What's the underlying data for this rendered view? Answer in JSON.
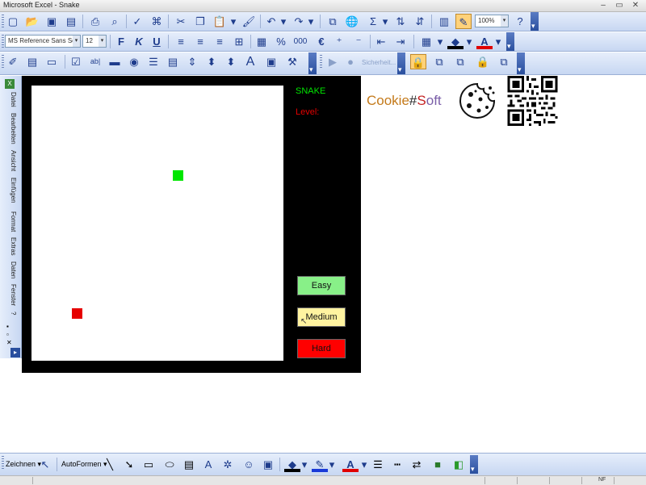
{
  "window": {
    "title": "Microsoft Excel - Snake",
    "minimize": "–",
    "restore": "▭",
    "close": "✕"
  },
  "formatting": {
    "font": "MS Reference Sans Serif",
    "size": "12",
    "zoom": "100%",
    "percent_symbol": "%",
    "thousands_symbol": "000",
    "euro_symbol": "€"
  },
  "controls_toolbar": {
    "security_label": "Sicherheit..."
  },
  "side_menu": [
    "Datei",
    "Bearbeiten",
    "Ansicht",
    "Einfügen",
    "Format",
    "Extras",
    "Daten",
    "Fenster",
    "?"
  ],
  "game": {
    "title": "SNAKE",
    "level_label": "Level:",
    "buttons": {
      "easy": "Easy",
      "medium": "Medium",
      "hard": "Hard"
    },
    "colors": {
      "background": "#000000",
      "board": "#ffffff",
      "snake": "#00e600",
      "food": "#e60000",
      "easy": "#88f088",
      "medium": "#fff3a0",
      "hard": "#ff0000"
    }
  },
  "logo": {
    "part1": "Cookie",
    "part2": "#",
    "part3": "S",
    "part4": "oft"
  },
  "drawing_toolbar": {
    "draw_menu": "Zeichnen",
    "autoshapes_menu": "AutoFormen"
  },
  "status": {
    "nf": "NF"
  }
}
